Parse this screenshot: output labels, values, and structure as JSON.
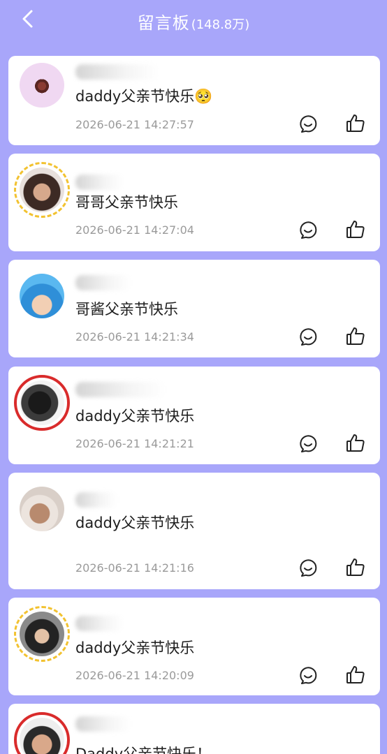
{
  "header": {
    "title": "留言板",
    "count": "(148.8万)",
    "back_icon": "chevron-left-icon"
  },
  "messages": [
    {
      "text": "daddy父亲节快乐🥺",
      "time": "2026-06-21 14:27:57"
    },
    {
      "text": "哥哥父亲节快乐",
      "time": "2026-06-21 14:27:04"
    },
    {
      "text": "哥酱父亲节快乐",
      "time": "2026-06-21 14:21:34"
    },
    {
      "text": "daddy父亲节快乐",
      "time": "2026-06-21 14:21:21"
    },
    {
      "text": "daddy父亲节快乐",
      "time": "2026-06-21 14:21:16"
    },
    {
      "text": "daddy父亲节快乐",
      "time": "2026-06-21 14:20:09"
    },
    {
      "text": "Daddy父亲节快乐！",
      "time": ""
    }
  ],
  "colors": {
    "background": "#A8A6FA",
    "card": "#FFFFFF",
    "text": "#1E1E1E",
    "timestamp": "#9A9A9A"
  },
  "icons": {
    "comment": "comment-bubble-icon",
    "like": "thumbs-up-icon"
  }
}
